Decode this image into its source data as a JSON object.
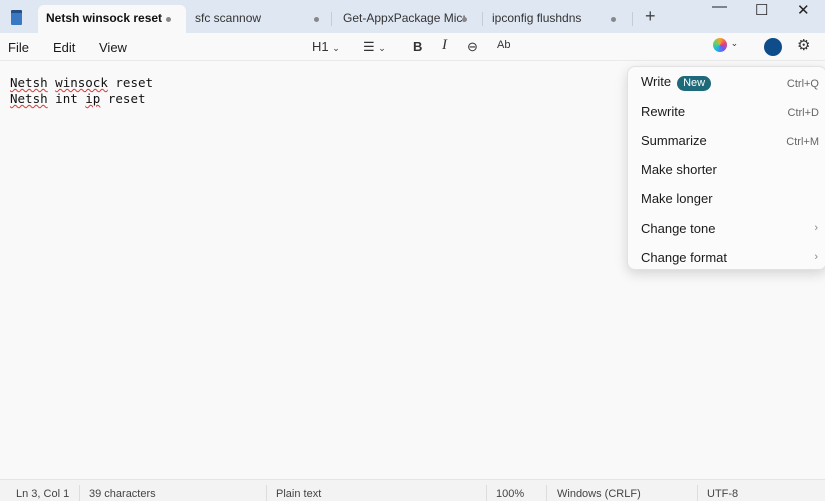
{
  "tabs": [
    {
      "label": "Netsh winsock reset"
    },
    {
      "label": "sfc scannow"
    },
    {
      "label": "Get-AppxPackage Micı"
    },
    {
      "label": "ipconfig flushdns"
    }
  ],
  "menu": {
    "file": "File",
    "edit": "Edit",
    "view": "View"
  },
  "toolbar": {
    "heading": "H1"
  },
  "editor": {
    "line1": [
      "Netsh",
      "winsock",
      "reset"
    ],
    "line2": [
      "Netsh",
      "int",
      "ip",
      "reset"
    ]
  },
  "ai_menu": {
    "items": [
      {
        "label": "Write",
        "badge": "New",
        "shortcut": "Ctrl+Q"
      },
      {
        "label": "Rewrite",
        "shortcut": "Ctrl+D"
      },
      {
        "label": "Summarize",
        "shortcut": "Ctrl+M"
      },
      {
        "label": "Make shorter"
      },
      {
        "label": "Make longer"
      },
      {
        "label": "Change tone"
      },
      {
        "label": "Change format"
      }
    ]
  },
  "status": {
    "position": "Ln 3, Col 1",
    "chars": "39 characters",
    "format": "Plain text",
    "zoom": "100%",
    "line_ending": "Windows (CRLF)",
    "encoding": "UTF-8"
  },
  "colors": {
    "accent": "#0f4c8a",
    "badge": "#1f6a7a"
  }
}
